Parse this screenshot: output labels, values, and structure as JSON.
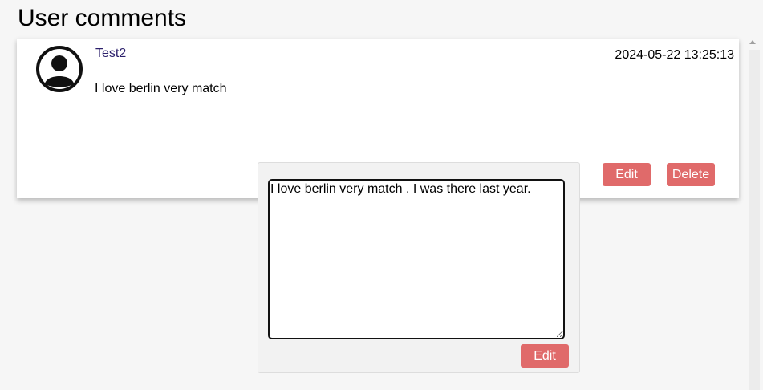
{
  "page": {
    "title": "User comments"
  },
  "comment": {
    "username": "Test2",
    "timestamp": "2024-05-22 13:25:13",
    "text": "I love berlin very match",
    "avatar_icon": "user-circle-icon",
    "edit_label": "Edit",
    "delete_label": "Delete"
  },
  "edit_popup": {
    "textarea_value": "I love berlin very match . I was there last year.",
    "submit_label": "Edit"
  },
  "colors": {
    "button_bg": "#e06a6a",
    "username": "#2b1f6b",
    "page_bg": "#f6f6f6"
  }
}
